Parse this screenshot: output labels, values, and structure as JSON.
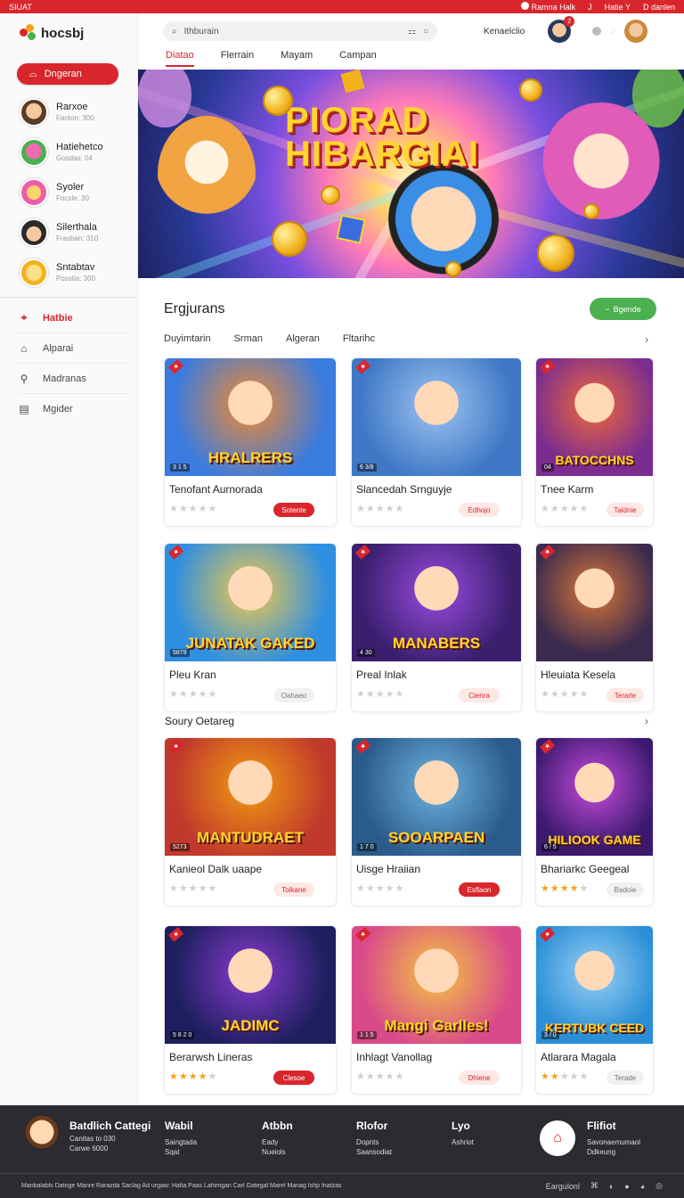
{
  "topbar": {
    "left": "SIUAT",
    "right": [
      "Ramna Halk",
      "J",
      "Hatie Y",
      "D danlen"
    ]
  },
  "logo": {
    "text": "hocsbj"
  },
  "sidebar": {
    "primary_button": "Dngeran",
    "friends": [
      {
        "name": "Rarxoe",
        "sub": "Fanton: 300",
        "color": "#5a3b26"
      },
      {
        "name": "Hatiehetco",
        "sub": "Gosdas: 04",
        "color": "#4caf50"
      },
      {
        "name": "Syoler",
        "sub": "Focsle: 30",
        "color": "#ef5da8"
      },
      {
        "name": "Silerthala",
        "sub": "Frasban: 310",
        "color": "#2a2a2a"
      },
      {
        "name": "Sntabtav",
        "sub": "Posstia: 300",
        "color": "#f2b21c"
      }
    ],
    "nav": [
      {
        "label": "Hatbie",
        "icon": "gamepad-icon",
        "glyph": "⌖",
        "active": true
      },
      {
        "label": "Alparai",
        "icon": "home-icon",
        "glyph": "⌂",
        "active": false
      },
      {
        "label": "Madranas",
        "icon": "wrench-icon",
        "glyph": "⚲",
        "active": false
      },
      {
        "label": "Mgider",
        "icon": "document-icon",
        "glyph": "▤",
        "active": false
      }
    ]
  },
  "header": {
    "search_value": "Ithburain",
    "user_label": "Kenaelclio",
    "notification_count": "2",
    "tabs": [
      {
        "label": "Diatao",
        "active": true
      },
      {
        "label": "Flerrain",
        "active": false
      },
      {
        "label": "Mayam",
        "active": false
      },
      {
        "label": "Campan",
        "active": false
      }
    ]
  },
  "hero": {
    "title_line1": "PIORAD",
    "title_line2": "HIBARGIAI"
  },
  "section": {
    "title": "Ergjurans",
    "action_button": "Bgende",
    "filters": [
      "Duyimtarin",
      "Srman",
      "Algeran",
      "Fltarihc"
    ],
    "subsection_title": "Soury Oetareg"
  },
  "cards": [
    {
      "name": "Tenofant Aurnorada",
      "art": "HRALRERS",
      "meta": "3 1 5",
      "stars": 0,
      "button": "Sotente",
      "button_style": "red",
      "colors": [
        "#3a7be0",
        "#f28a2e"
      ]
    },
    {
      "name": "Slancedah Srnguyje",
      "art": "",
      "meta": "6 3/8",
      "stars": 0,
      "button": "Edhojo",
      "button_style": "light",
      "colors": [
        "#3e78c6",
        "#9fc4f0"
      ]
    },
    {
      "name": "Tnee Karm",
      "art": "BATOCCHNS",
      "meta": "04",
      "stars": 0,
      "button": "Taldnie",
      "button_style": "light",
      "colors": [
        "#7a2c8f",
        "#f26a3a"
      ]
    },
    {
      "name": "Pleu Kran",
      "art": "JUNATAK GAKED",
      "meta": "5879",
      "stars": 0,
      "button": "Oahaeo",
      "button_style": "grey",
      "colors": [
        "#2f8fe0",
        "#f2c94c"
      ]
    },
    {
      "name": "Preal Inlak",
      "art": "MANABERS",
      "meta": "4 30",
      "stars": 0,
      "button": "Cienra",
      "button_style": "light",
      "colors": [
        "#3a1f6e",
        "#9b4be0"
      ]
    },
    {
      "name": "Hleuiata Kesela",
      "art": "",
      "meta": "",
      "stars": 0,
      "button": "Terarle",
      "button_style": "light",
      "colors": [
        "#3a2a4e",
        "#d9773a"
      ]
    },
    {
      "name": "Kanieol Dalk uaape",
      "art": "MANTUDRAET",
      "meta": "5273",
      "stars": 0,
      "button": "Tolkane",
      "button_style": "light",
      "colors": [
        "#c0392b",
        "#f39c12"
      ]
    },
    {
      "name": "Uisge Hraiian",
      "art": "SOOARPAEN",
      "meta": "1 7 0",
      "stars": 0,
      "button": "Esflaon",
      "button_style": "red",
      "colors": [
        "#2a5b8a",
        "#6fb3e0"
      ]
    },
    {
      "name": "Bhariarkc Geegeal",
      "art": "HILIOOK GAME",
      "meta": "6 / 5",
      "stars": 4,
      "button": "Badoie",
      "button_style": "grey",
      "colors": [
        "#3b1a6e",
        "#c94be0"
      ]
    },
    {
      "name": "Berarwsh Lineras",
      "art": "JADIMC",
      "meta": "5 8 2 0",
      "stars": 4,
      "button": "Clesoe",
      "button_style": "red",
      "colors": [
        "#1d1f5e",
        "#8a3bd0"
      ]
    },
    {
      "name": "Inhlagt Vanollag",
      "art": "Mangi Garlles!",
      "meta": "1 1 5",
      "stars": 0,
      "button": "Dhiene",
      "button_style": "light",
      "colors": [
        "#d94a8a",
        "#f5c542"
      ]
    },
    {
      "name": "Atlarara Magala",
      "art": "KERTUBK CEED",
      "meta": "3 / 0",
      "stars": 2,
      "button": "Terade",
      "button_style": "grey",
      "colors": [
        "#2a8fd6",
        "#9ad0f5"
      ]
    }
  ],
  "footer": {
    "brand": "Batdlich Cattegi",
    "brand_sub": [
      "Canitas to 030",
      "Carwe 6000"
    ],
    "columns": [
      {
        "title": "Wabil",
        "links": [
          "Saingtada",
          "Sqat"
        ]
      },
      {
        "title": "Atbbn",
        "links": [
          "Eady",
          "Nueiols"
        ]
      },
      {
        "title": "Rlofor",
        "links": [
          "Dopnts",
          "Saansodiat"
        ]
      },
      {
        "title": "Lyo",
        "links": [
          "Ashriot"
        ]
      }
    ],
    "right_title": "Flifiot",
    "right_links": [
      "Savonaemumaol",
      "Ddkeung"
    ],
    "copyright": "Manbalabls Datnge Manre Rarazda Saclag Ad urgaw: Halta Paas Lahimgan Carl Gategal Marel Manag Ishp Inatzas",
    "bottom_right": "Eargulonl"
  }
}
